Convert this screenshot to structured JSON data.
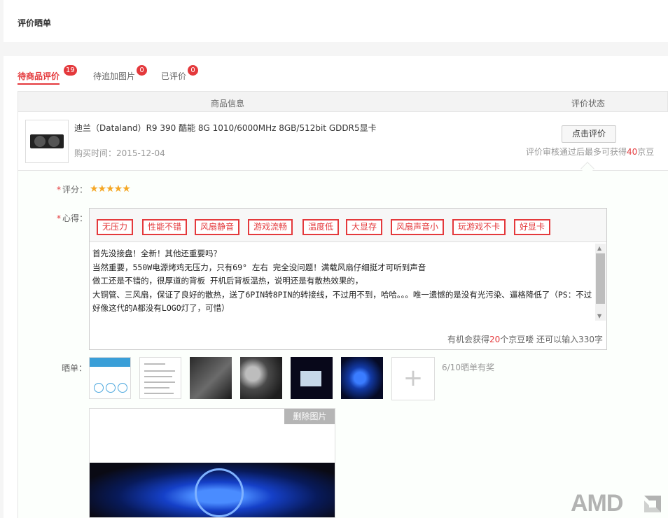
{
  "header": {
    "title": "评价晒单"
  },
  "tabs": [
    {
      "label": "待商品评价",
      "count": "19"
    },
    {
      "label": "待追加图片",
      "count": "0"
    },
    {
      "label": "已评价",
      "count": "0"
    }
  ],
  "table": {
    "col_product": "商品信息",
    "col_status": "评价状态"
  },
  "product": {
    "name": "迪兰（Dataland）R9 390 酷能 8G 1010/6000MHz 8GB/512bit GDDR5显卡",
    "purchase_time": "购买时间：2015-12-04",
    "eval_button": "点击评价",
    "eval_tip_prefix": "评价审核通过后最多可获得",
    "eval_tip_beans": "40",
    "eval_tip_suffix": "京豆"
  },
  "review": {
    "rating_label": "评分：",
    "rating_required": "*",
    "stars": "★★★★★",
    "rating_value": 5,
    "experience_label": "心得：",
    "experience_required": "*",
    "tags": [
      "无压力",
      "性能不错",
      "风扇静音",
      "游戏流畅",
      "温度低",
      "大显存",
      "风扇声音小",
      "玩游戏不卡",
      "好显卡"
    ],
    "text": "首先没接盘！全新！其他还重要吗？\n当然重要，550W电源烤鸡无压力，只有69° 左右 完全没问题！满载风扇仔细挺才可听到声音\n做工还是不错的，很厚道的背板 开机后背板温热，说明还是有散热效果的，\n大铜管、三风扇，保证了良好的散热，送了6PIN转8PIN的转接线，不过用不到，哈哈。。。唯一遗憾的是没有光污染、逼格降低了（PS：不过好像这代的A都没有LOGO灯了，可惜）",
    "counter_prefix": "有机会获得",
    "counter_beans": "20",
    "counter_suffix": "个京豆喽 还可以输入330字",
    "photos_label": "晒单：",
    "add_symbol": "+",
    "photos_tip": "6/10晒单有奖",
    "delete_photo": "删除图片"
  },
  "watermark": {
    "text": "AMD"
  }
}
